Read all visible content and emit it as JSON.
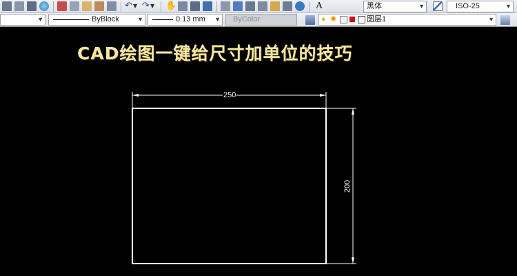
{
  "toolbar_top": {
    "font_value": "黑体",
    "dimstyle_value": "ISO-25",
    "icons": [
      "print-icon",
      "preview-icon",
      "publish-icon",
      "globe-icon",
      "cut-icon",
      "copy-icon",
      "paste-icon",
      "match-properties-icon",
      "block-editor-icon",
      "undo-icon",
      "redo-icon",
      "pan-icon",
      "zoom-realtime-icon",
      "zoom-window-icon",
      "zoom-previous-icon",
      "properties-icon",
      "design-center-icon",
      "tool-palettes-icon",
      "sheet-set-icon",
      "markup-icon",
      "quickcalc-icon",
      "text-style-icon",
      "dim-style-icon"
    ]
  },
  "toolbar_props": {
    "linetype_value": "ByBlock",
    "lineweight_value": "0.13 mm",
    "plotstyle_value": "ByColor",
    "layer_value": "图层1",
    "layer_icons": [
      "layer-manager-icon",
      "lightbulb-icon",
      "sun-icon",
      "lock-icon",
      "color-swatch-icon"
    ]
  },
  "canvas": {
    "title": "CAD绘图一键给尺寸加单位的技巧",
    "horizontal_dimension": "250",
    "vertical_dimension": "200",
    "colors": {
      "background": "#000000",
      "geometry": "#ffffff",
      "title": "#f6e7a6"
    }
  }
}
